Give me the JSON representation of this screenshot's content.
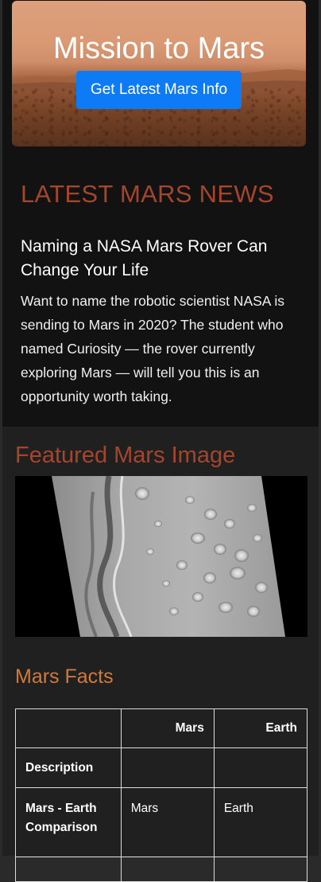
{
  "hero": {
    "title": "Mission to Mars",
    "button_label": "Get Latest Mars Info"
  },
  "news": {
    "heading": "LATEST MARS NEWS",
    "title": "Naming a NASA Mars Rover Can Change Your Life",
    "body": "Want to name the robotic scientist NASA is sending to Mars in 2020? The student who named Curiosity — the rover currently exploring Mars — will tell you this is an opportunity worth taking."
  },
  "featured": {
    "heading": "Featured Mars Image"
  },
  "facts": {
    "heading": "Mars Facts",
    "columns": [
      "",
      "Mars",
      "Earth"
    ],
    "rows": [
      {
        "label": "Description",
        "mars": "",
        "earth": ""
      },
      {
        "label": "Mars - Earth Comparison",
        "mars": "Mars",
        "earth": "Earth"
      }
    ]
  },
  "colors": {
    "accent_heading": "#a5452c",
    "facts_heading": "#d17a3d",
    "button": "#0d7bf5",
    "page_background": "#121212",
    "section_background": "#202020"
  }
}
